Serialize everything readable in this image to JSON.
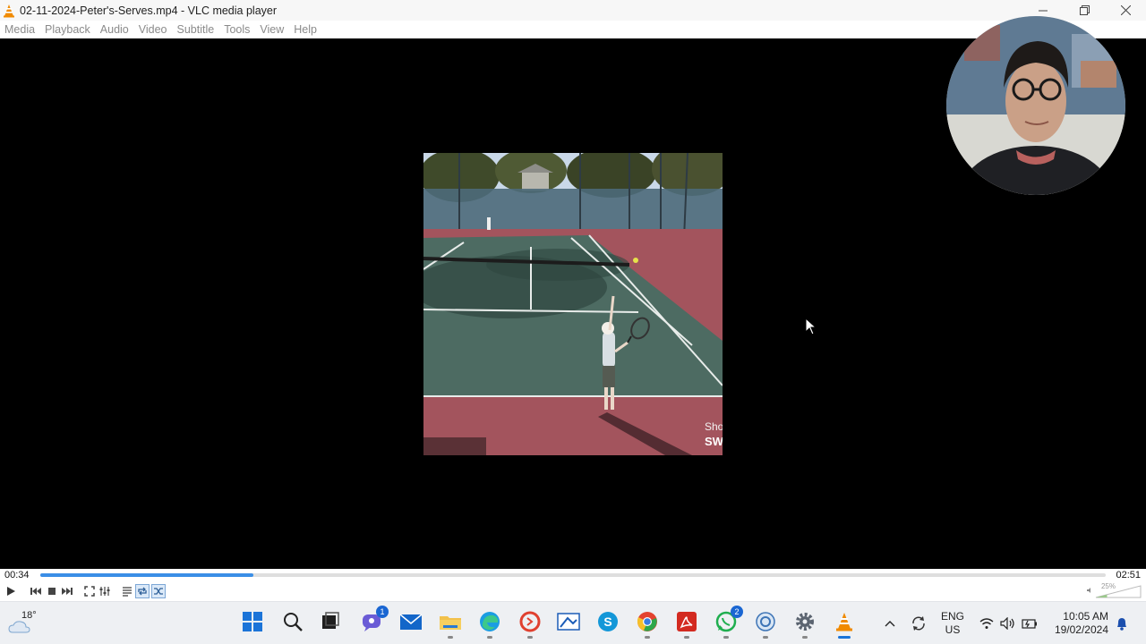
{
  "window": {
    "title": "02-11-2024-Peter's-Serves.mp4 - VLC media player",
    "controls": [
      "minimize",
      "restore",
      "close"
    ]
  },
  "menu": {
    "items": [
      "Media",
      "Playback",
      "Audio",
      "Video",
      "Subtitle",
      "Tools",
      "View",
      "Help"
    ]
  },
  "video": {
    "overlay_text_1": "Sho",
    "overlay_text_2": "SW"
  },
  "playback": {
    "current_time": "00:34",
    "total_time": "02:51",
    "progress": 0.2,
    "volume_label": "25%",
    "volume": 0.25,
    "loop_active": true,
    "shuffle_active": true
  },
  "controls": {
    "icons": [
      "play-icon",
      "previous-icon",
      "stop-icon",
      "next-icon",
      "fullscreen-icon",
      "extended-settings-icon",
      "playlist-icon",
      "loop-icon",
      "shuffle-icon"
    ]
  },
  "taskbar": {
    "weather_temp": "18°",
    "apps": [
      {
        "name": "windows-start",
        "badge": ""
      },
      {
        "name": "search",
        "badge": ""
      },
      {
        "name": "task-view",
        "badge": ""
      },
      {
        "name": "teams-chat",
        "badge": "1"
      },
      {
        "name": "mail",
        "badge": ""
      },
      {
        "name": "file-explorer",
        "badge": ""
      },
      {
        "name": "edge",
        "badge": ""
      },
      {
        "name": "screen-recorder",
        "badge": ""
      },
      {
        "name": "screenshot-tool",
        "badge": ""
      },
      {
        "name": "skype",
        "badge": ""
      },
      {
        "name": "chrome",
        "badge": ""
      },
      {
        "name": "acrobat",
        "badge": ""
      },
      {
        "name": "whatsapp",
        "badge": "2"
      },
      {
        "name": "control-panel",
        "badge": ""
      },
      {
        "name": "settings",
        "badge": ""
      },
      {
        "name": "vlc",
        "badge": ""
      }
    ],
    "lang_line1": "ENG",
    "lang_line2": "US",
    "time": "10:05 AM",
    "date": "19/02/2024"
  }
}
